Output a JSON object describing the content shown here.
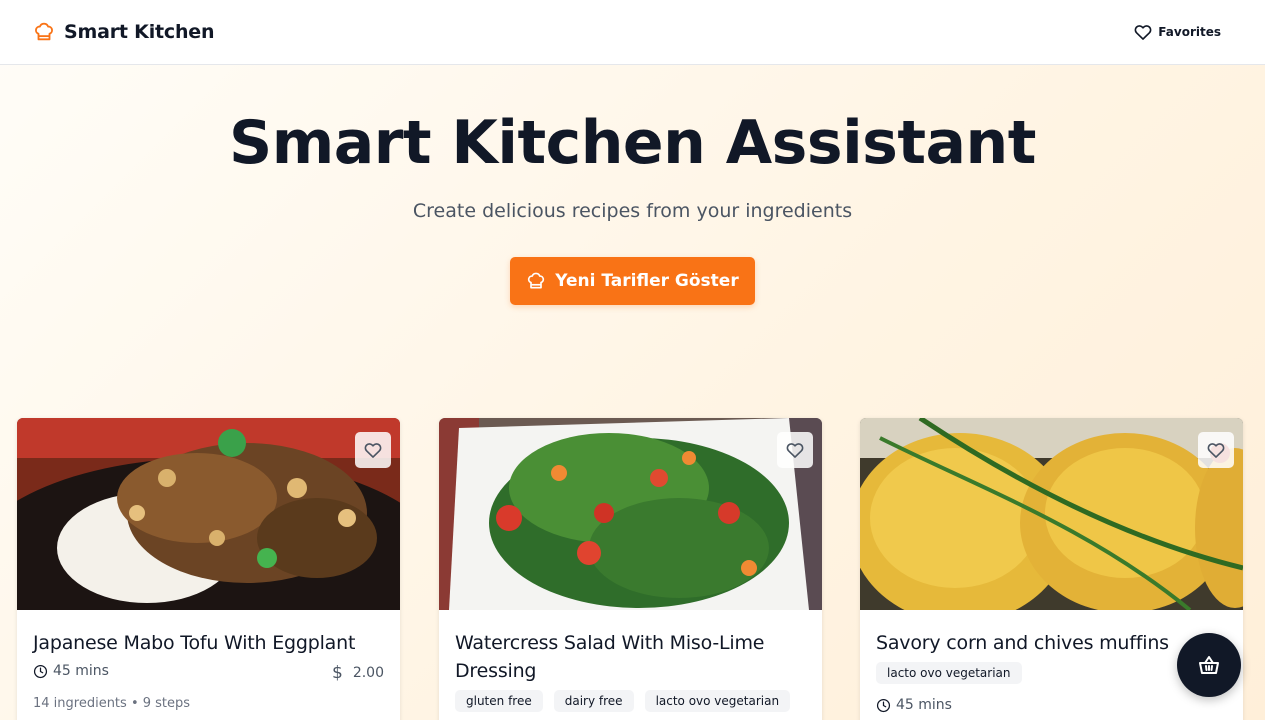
{
  "header": {
    "brand": "Smart Kitchen",
    "favorites_label": "Favorites"
  },
  "hero": {
    "title": "Smart Kitchen Assistant",
    "subtitle": "Create delicious recipes from your ingredients",
    "cta_label": "Yeni Tarifler Göster"
  },
  "colors": {
    "accent": "#f97316",
    "text": "#111827",
    "fab": "#111827"
  },
  "recipes": [
    {
      "title": "Japanese Mabo Tofu With Eggplant",
      "time": "45 mins",
      "price": "2.00",
      "info": "14 ingredients • 9 steps",
      "tags": [],
      "image_icon": "mabo-tofu-photo"
    },
    {
      "title": "Watercress Salad With Miso-Lime Dressing",
      "tags": [
        "gluten free",
        "dairy free",
        "lacto ovo vegetarian"
      ],
      "image_icon": "watercress-salad-photo"
    },
    {
      "title": "Savory corn and chives muffins",
      "tags": [
        "lacto ovo vegetarian"
      ],
      "time": "45 mins",
      "image_icon": "corn-muffins-photo"
    }
  ],
  "icons": {
    "brand": "chef-hat-icon",
    "favorites": "heart-icon",
    "cta": "chef-hat-icon",
    "time": "clock-icon",
    "price": "dollar-icon",
    "fab": "basket-icon"
  }
}
